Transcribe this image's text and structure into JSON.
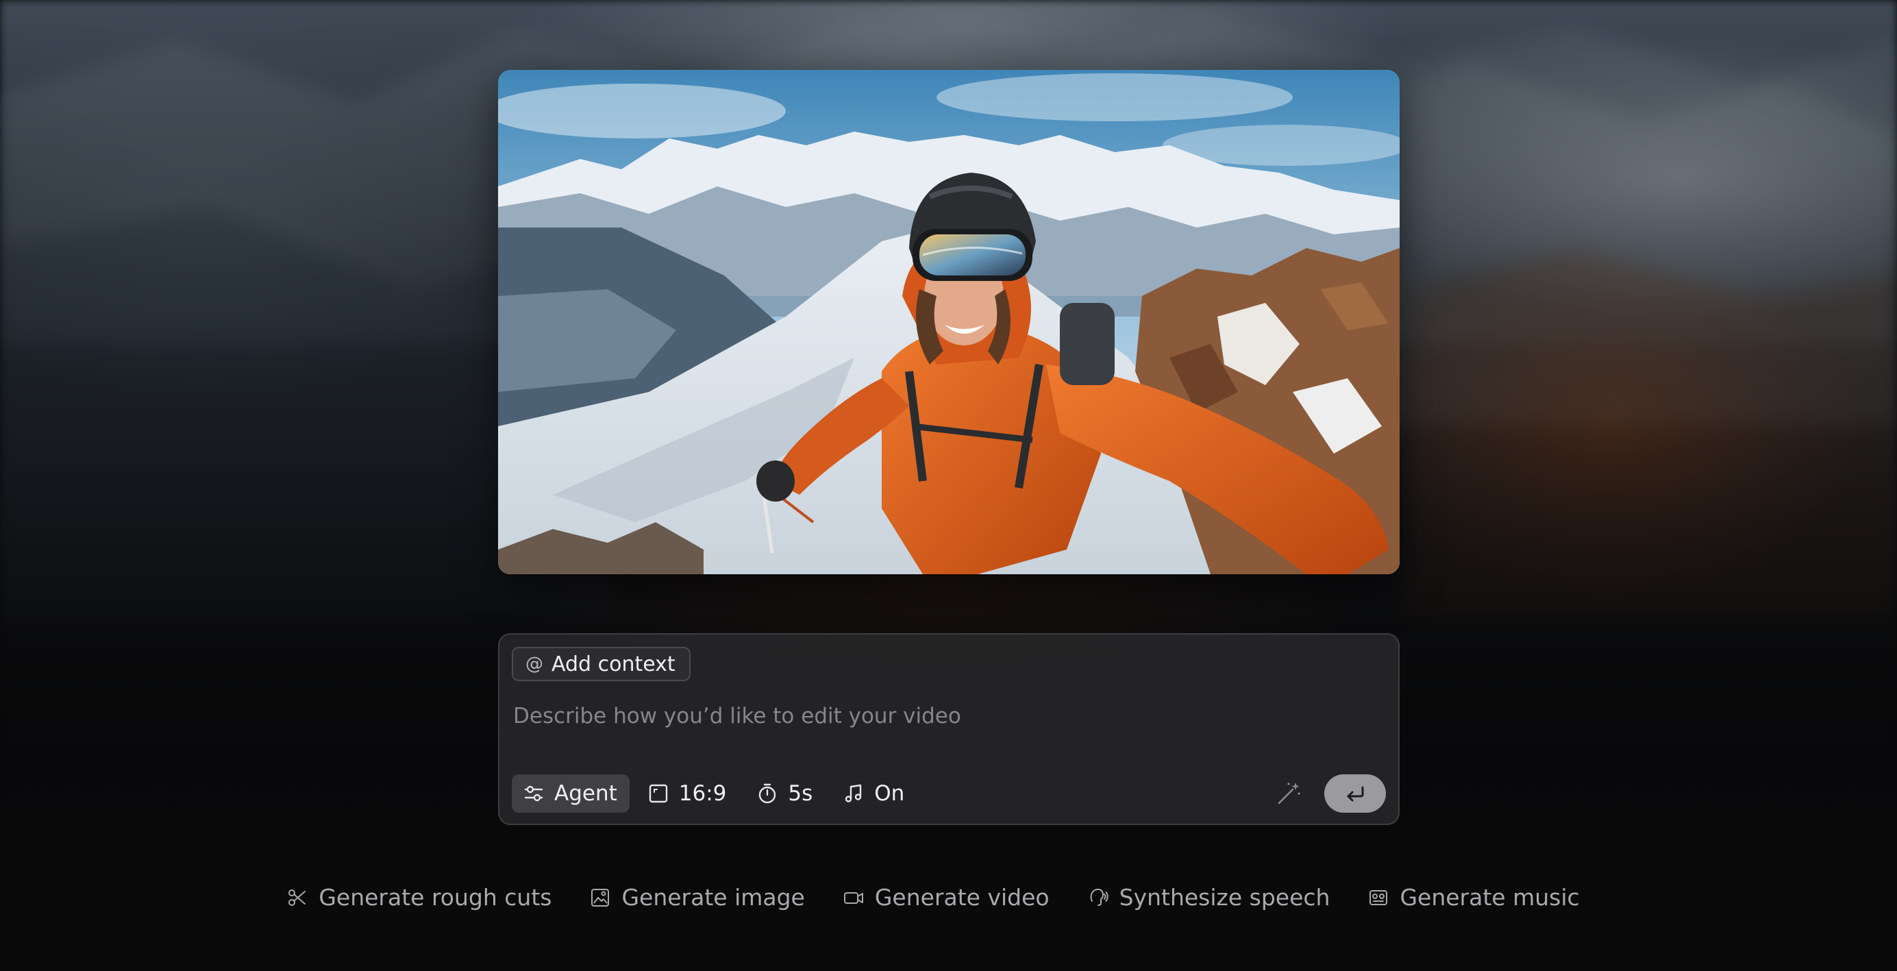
{
  "composer": {
    "add_context_label": "Add context",
    "prompt_placeholder": "Describe how you’d like to edit your video",
    "toolbar": {
      "mode_label": "Agent",
      "aspect_label": "16:9",
      "duration_label": "5s",
      "audio_label": "On"
    }
  },
  "suggestions": [
    {
      "label": "Generate rough cuts",
      "icon": "scissors-icon"
    },
    {
      "label": "Generate image",
      "icon": "image-icon"
    },
    {
      "label": "Generate video",
      "icon": "video-camera-icon"
    },
    {
      "label": "Synthesize speech",
      "icon": "speech-icon"
    },
    {
      "label": "Generate music",
      "icon": "music-box-icon"
    }
  ],
  "colors": {
    "background": "#0a0a0b",
    "composer_bg": "#262628",
    "send_button": "#9a9a9f",
    "jacket_orange": "#e0621e"
  }
}
